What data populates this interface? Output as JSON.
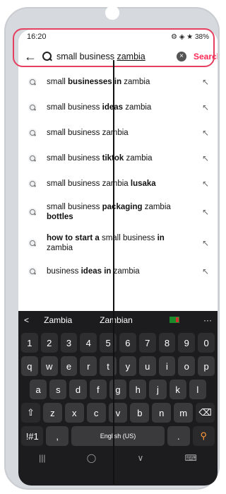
{
  "status": {
    "time": "16:20",
    "right": "⚙ ◈ ★ 38%"
  },
  "search": {
    "back_icon": "←",
    "query_plain": "small business ",
    "query_underlined": "zambia",
    "clear_icon": "×",
    "search_label": "Search"
  },
  "suggestions": [
    {
      "pre": "small ",
      "bold": "businesses in",
      "post": " zambia"
    },
    {
      "pre": "small business ",
      "bold": "ideas",
      "post": " zambia"
    },
    {
      "pre": "small business zambia",
      "bold": "",
      "post": ""
    },
    {
      "pre": "small business ",
      "bold": "tiktok",
      "post": " zambia"
    },
    {
      "pre": "small business zambia ",
      "bold": "lusaka",
      "post": ""
    },
    {
      "pre": "small business ",
      "bold": "packaging",
      "post": " zambia",
      "line2": "bottles"
    },
    {
      "pre": "",
      "bold": "how to start a",
      "post": " small business ",
      "bold2": "in",
      "line2": "zambia"
    },
    {
      "pre": "business ",
      "bold": "ideas in",
      "post": " zambia"
    }
  ],
  "keyboard": {
    "predictions": {
      "chevron": "<",
      "p1": "Zambia",
      "p2": "Zambian",
      "more": "···"
    },
    "numbers": [
      "1",
      "2",
      "3",
      "4",
      "5",
      "6",
      "7",
      "8",
      "9",
      "0"
    ],
    "row1": [
      "q",
      "w",
      "e",
      "r",
      "t",
      "y",
      "u",
      "i",
      "o",
      "p"
    ],
    "row2": [
      "a",
      "s",
      "d",
      "f",
      "g",
      "h",
      "j",
      "k",
      "l"
    ],
    "row3": [
      "z",
      "x",
      "c",
      "v",
      "b",
      "n",
      "m"
    ],
    "shift": "⇧",
    "backspace": "⌫",
    "symbols": "!#1",
    "comma": ",",
    "space": "English (US)",
    "period": ".",
    "search_key": "⚲"
  },
  "navbar": {
    "recents": "|||",
    "home": "◯",
    "back": "∨",
    "kbd": "⌨"
  }
}
